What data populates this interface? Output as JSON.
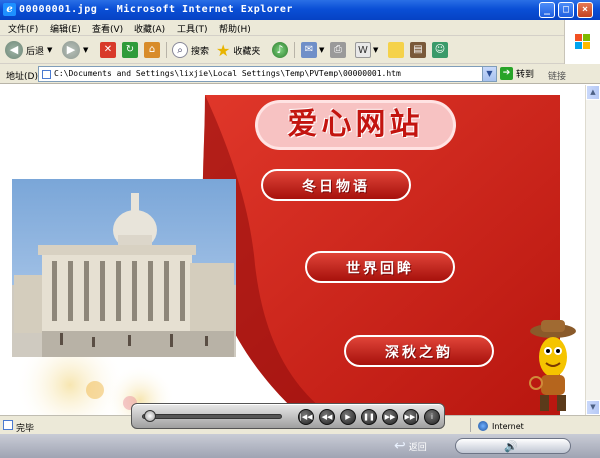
{
  "window": {
    "title": "00000001.jpg - Microsoft Internet Explorer",
    "controls": [
      "_",
      "□",
      "×"
    ]
  },
  "menubar": {
    "items": [
      "文件(F)",
      "编辑(E)",
      "查看(V)",
      "收藏(A)",
      "工具(T)",
      "帮助(H)"
    ]
  },
  "toolbar": {
    "back_label": "后退",
    "search_label": "搜索",
    "favorites_label": "收藏夹"
  },
  "address": {
    "label": "地址(D)",
    "value": "C:\\Documents and Settings\\lixjie\\Local Settings\\Temp\\PVTemp\\00000001.htm",
    "go_label": "转到",
    "links_label": "链接"
  },
  "page": {
    "site_title": "爱心网站",
    "menu": [
      "冬日物语",
      "世界回眸",
      "深秋之韵"
    ],
    "colors": {
      "brand_red": "#d42a20",
      "dark_red": "#9e0f0f"
    }
  },
  "statusbar": {
    "text": "完毕",
    "zone": "Internet"
  },
  "player": {
    "progress": 0.03,
    "buttons": [
      "first",
      "previous",
      "play",
      "pause",
      "next",
      "last",
      "info"
    ]
  },
  "bottom": {
    "back_label": "返回"
  }
}
